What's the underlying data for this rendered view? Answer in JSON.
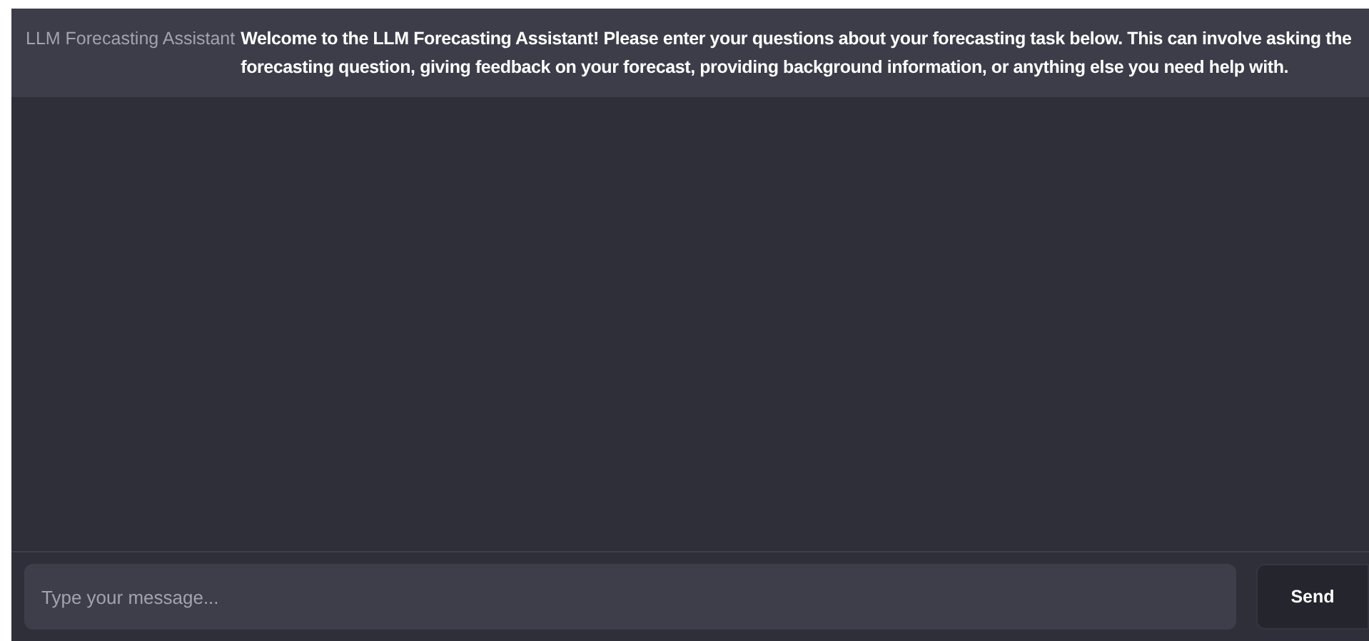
{
  "messages": [
    {
      "sender": "LLM Forecasting Assistant",
      "text": "Welcome to the LLM Forecasting Assistant! Please enter your questions about your forecasting task below. This can involve asking the forecasting question, giving feedback on your forecast, providing background information, or anything else you need help with."
    }
  ],
  "composer": {
    "placeholder": "Type your message...",
    "send_label": "Send"
  }
}
